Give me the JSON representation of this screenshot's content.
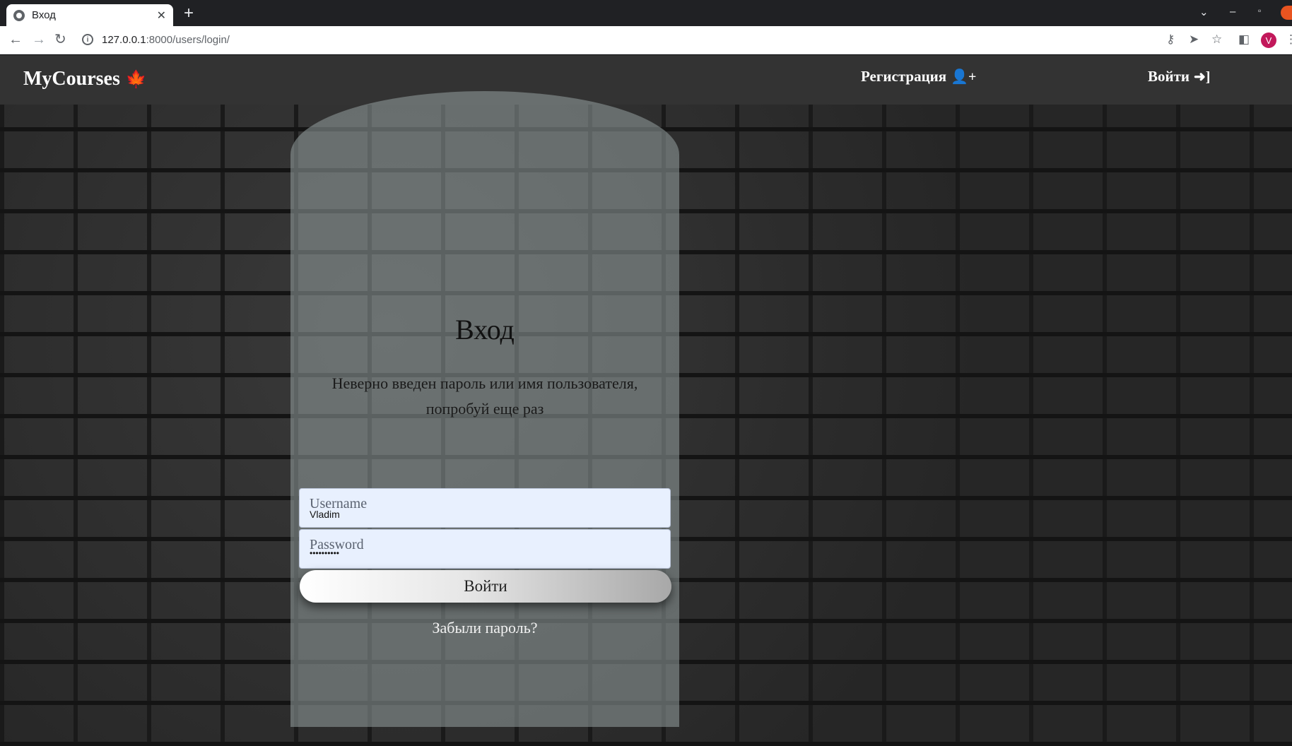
{
  "browser": {
    "tab_title": "Вход",
    "url_host": "127.0.0.1",
    "url_path": ":8000/users/login/",
    "avatar_letter": "V"
  },
  "navbar": {
    "brand": "MyCourses",
    "register_label": "Регистрация",
    "login_label": "Войти"
  },
  "login": {
    "heading": "Вход",
    "error_message": "Неверно введен пароль или имя пользователя, попробуй еще раз",
    "username_placeholder": "Username",
    "username_value": "Vladim",
    "password_placeholder": "Password",
    "password_value": "••••••••••",
    "submit_label": "Войти",
    "forgot_link": "Забыли пароль?"
  },
  "colors": {
    "navbar_bg": "#333333",
    "input_bg": "#e8f0fe",
    "card_overlay": "rgba(150,160,160,0.55)"
  },
  "icons": {
    "brand": "maple-leaf-icon",
    "register": "user-plus-icon",
    "login": "sign-in-icon"
  }
}
